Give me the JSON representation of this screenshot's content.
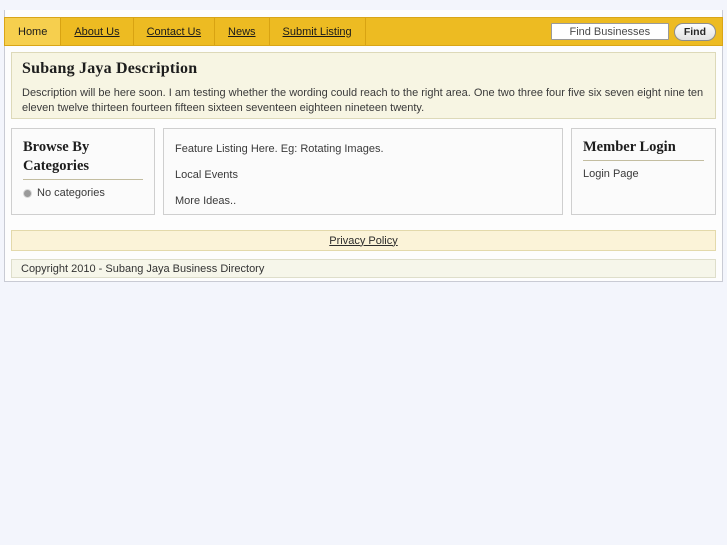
{
  "nav": {
    "tabs": [
      {
        "label": "Home",
        "active": true
      },
      {
        "label": "About Us",
        "active": false
      },
      {
        "label": "Contact Us",
        "active": false
      },
      {
        "label": "News",
        "active": false
      },
      {
        "label": "Submit Listing",
        "active": false
      }
    ],
    "search": {
      "value": "Find Businesses",
      "placeholder": "Find Businesses",
      "button_label": "Find"
    }
  },
  "description": {
    "title": "Subang Jaya Description",
    "body": "Description will be here soon. I am testing whether the wording could reach to the right area. One two three four five six seven eight nine ten eleven twelve thirteen fourteen fifteen sixteen seventeen eighteen nineteen twenty."
  },
  "categories_panel": {
    "title": "Browse By Categories",
    "items": [
      {
        "label": "No categories",
        "icon": "bullet-disc-icon"
      }
    ]
  },
  "feature_panel": {
    "lines": [
      "Feature Listing Here. Eg: Rotating Images.",
      "Local Events",
      "More Ideas.."
    ]
  },
  "login_panel": {
    "title": "Member Login",
    "link_label": "Login Page"
  },
  "footer": {
    "privacy_label": "Privacy Policy",
    "copyright": "Copyright 2010 - Subang Jaya Business Directory"
  },
  "colors": {
    "nav_bar": "#edbb22",
    "nav_active_tab": "#f6cf4e",
    "description_bg": "#f7f5e3",
    "privacy_bg": "#fbf3d8",
    "copyright_bg": "#f6f6ea",
    "page_bg": "#f3f5fc"
  }
}
